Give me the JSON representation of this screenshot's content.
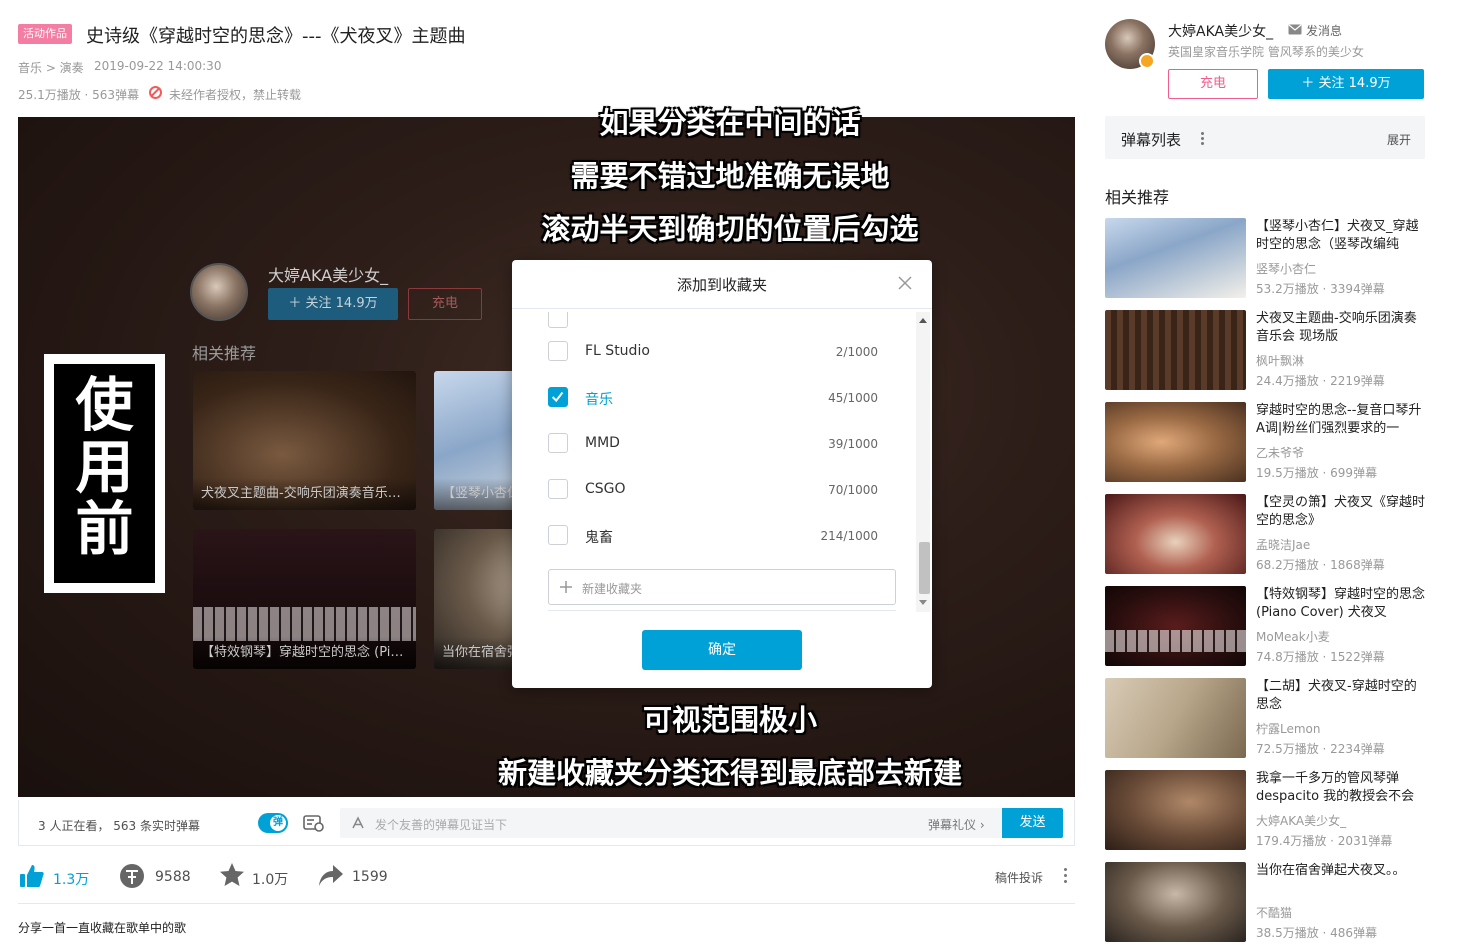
{
  "video": {
    "badge": "活动作品",
    "title": "史诗级《穿越时空的思念》---《犬夜叉》主题曲",
    "breadcrumb": "音乐 > 演奏",
    "date": "2019-09-22 14:00:30",
    "stats": "25.1万播放 · 563弹幕",
    "copyright": "未经作者授权，禁止转载"
  },
  "endcard": {
    "up_name": "大婷AKA美少女_",
    "follow_label": "＋ 关注 14.9万",
    "charge_label": "充电",
    "heading": "相关推荐",
    "items": [
      {
        "caption": "犬夜叉主题曲-交响乐团演奏音乐会 现场版"
      },
      {
        "caption": "【竖琴小杏仁】犬夜叉_穿越时空的思念"
      },
      {
        "caption": "【特效钢琴】穿越时空的思念 (Piano Cover)"
      },
      {
        "caption": "当你在宿舍弹起犬夜叉。。"
      }
    ]
  },
  "captions": {
    "top": [
      "如果分类在中间的话",
      "需要不错过地准确无误地",
      "滚动半天到确切的位置后勾选"
    ],
    "bottom": [
      "可视范围极小",
      "新建收藏夹分类还得到最底部去新建"
    ],
    "before_label": "使用前"
  },
  "modal": {
    "title": "添加到收藏夹",
    "folders": [
      {
        "name": "FL Studio",
        "count": "2/1000",
        "checked": false
      },
      {
        "name": "音乐",
        "count": "45/1000",
        "checked": true
      },
      {
        "name": "MMD",
        "count": "39/1000",
        "checked": false
      },
      {
        "name": "CSGO",
        "count": "70/1000",
        "checked": false
      },
      {
        "name": "鬼畜",
        "count": "214/1000",
        "checked": false
      }
    ],
    "new_folder": "新建收藏夹",
    "confirm": "确定"
  },
  "player_bar": {
    "viewers": "3 人正在看， 563 条实时弹幕",
    "toggle_glyph": "弹",
    "input_placeholder": "发个友善的弹幕见证当下",
    "etiquette": "弹幕礼仪 ›",
    "send": "发送"
  },
  "actions": {
    "like": "1.3万",
    "coin": "9588",
    "fav": "1.0万",
    "share": "1599",
    "report": "稿件投诉"
  },
  "description": "分享一首一直收藏在歌单中的歌",
  "sidebar": {
    "up_name": "大婷AKA美少女_",
    "message": "发消息",
    "sign": "英国皇家音乐学院 管风琴系的美少女",
    "charge": "充电",
    "follow": "＋  关注 14.9万",
    "danmaku_list": "弹幕列表",
    "expand": "展开",
    "heading": "相关推荐",
    "recommendations": [
      {
        "title": "【竖琴小杏仁】犬夜叉_穿越时空的思念（竖琴改编纯",
        "up": "竖琴小杏仁",
        "stats": "53.2万播放 · 3394弹幕"
      },
      {
        "title": "犬夜叉主题曲-交响乐团演奏音乐会 现场版",
        "up": "枫叶飘淋",
        "stats": "24.4万播放 · 2219弹幕"
      },
      {
        "title": "穿越时空的思念--复音口琴升A调|粉丝们强烈要求的一",
        "up": "乙未爷爷",
        "stats": "19.5万播放 · 699弹幕"
      },
      {
        "title": "【空灵の箫】犬夜叉《穿越时空的思念》",
        "up": "孟晓洁Jae",
        "stats": "68.2万播放 · 1868弹幕"
      },
      {
        "title": "【特效钢琴】穿越时空的思念 (Piano Cover) 犬夜叉",
        "up": "MoMeak小麦",
        "stats": "74.8万播放 · 1522弹幕"
      },
      {
        "title": "【二胡】犬夜叉-穿越时空的思念",
        "up": "柠露Lemon",
        "stats": "72.5万播放 · 2234弹幕"
      },
      {
        "title": "我拿一千多万的管风琴弹despacito 我的教授会不会",
        "up": "大婷AKA美少女_",
        "stats": "179.4万播放 · 2031弹幕"
      },
      {
        "title": "当你在宿舍弹起犬夜叉。。",
        "up": "不酷猫",
        "stats": "38.5万播放 · 486弹幕"
      }
    ]
  }
}
